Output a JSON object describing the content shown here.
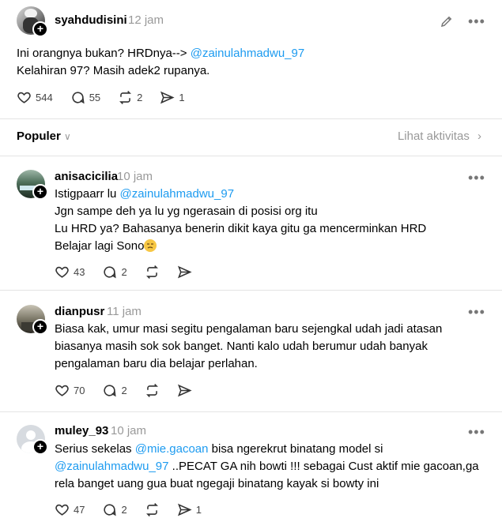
{
  "main_post": {
    "username": "syahdudisini",
    "time": "12 jam",
    "text_line1_a": "Ini orangnya bukan? HRDnya-->",
    "mention": "@zainulahmadwu_97",
    "text_line2": "Kelahiran 97? Masih adek2 rupanya.",
    "likes": "544",
    "replies": "55",
    "reposts": "2",
    "shares": "1"
  },
  "sort_bar": {
    "label": "Populer",
    "activity_link": "Lihat aktivitas"
  },
  "replies": [
    {
      "username": "anisacicilia",
      "time": "10 jam",
      "mention": "@zainulahmadwu_97",
      "line1_prefix": "Istigpaarr lu",
      "line2": "Jgn sampe deh ya lu yg ngerasain di posisi org itu",
      "line3": "Lu HRD ya? Bahasanya benerin dikit kaya gitu ga mencerminkan HRD",
      "line4": "Belajar lagi Sono",
      "likes": "43",
      "replies": "2"
    },
    {
      "username": "dianpusr",
      "time": "11 jam",
      "line1": "Biasa kak, umur masi segitu pengalaman baru sejengkal udah jadi atasan",
      "line2": "biasanya masih sok sok banget. Nanti kalo udah berumur udah banyak",
      "line3": "pengalaman baru dia belajar perlahan.",
      "likes": "70",
      "replies": "2"
    },
    {
      "username": "muley_93",
      "time": "10 jam",
      "line1_prefix": "Serius sekelas",
      "mention1": "@mie.gacoan",
      "line1_suffix": "bisa ngerekrut binatang model si",
      "mention2": "@zainulahmadwu_97",
      "line2_suffix": "..PECAT GA nih bowti !!! sebagai Cust aktif mie gacoan,ga",
      "line3": "rela banget uang gua buat ngegaji binatang kayak si bowty ini",
      "likes": "47",
      "replies": "2",
      "shares": "1"
    }
  ]
}
